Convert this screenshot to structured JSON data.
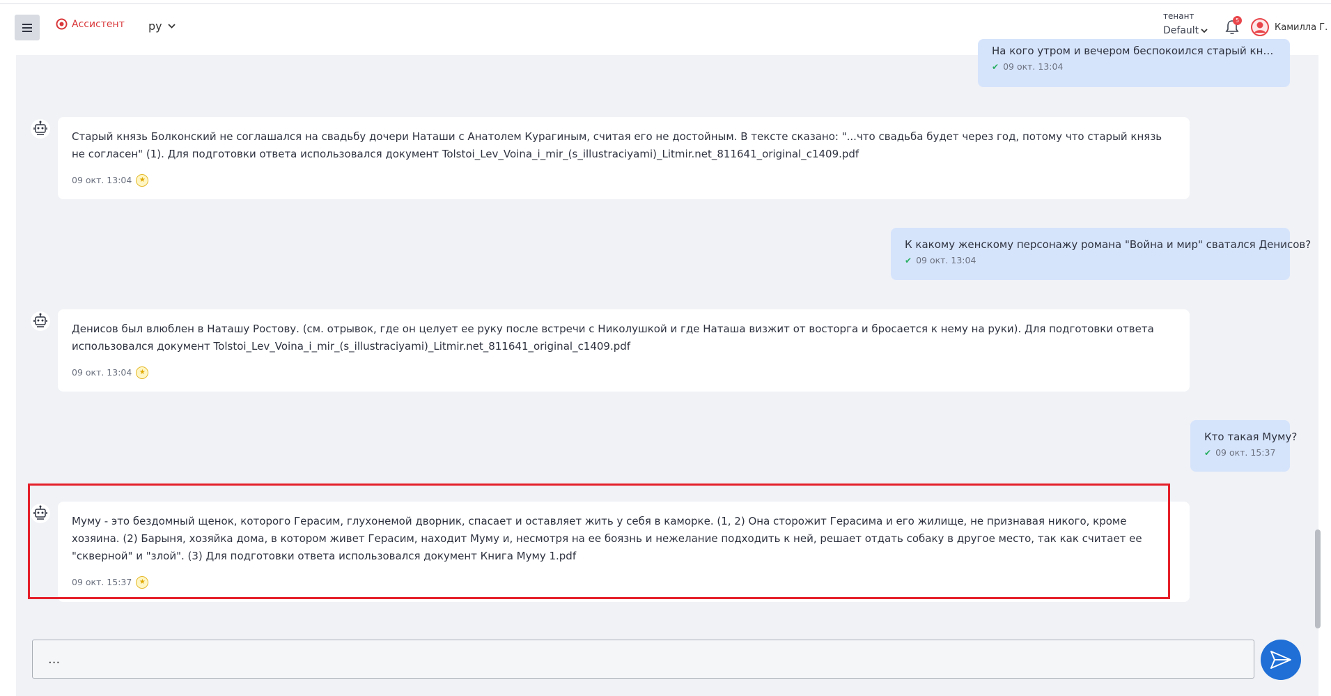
{
  "header": {
    "logo_text": "Ассистент",
    "language": "ру",
    "tenant_label": "тенант",
    "tenant_value": "Default",
    "notifications_count": "5",
    "user_name": "Камилла Г."
  },
  "messages": [
    {
      "role": "user",
      "text": "На кого утром и вечером беспокоился старый князь Болконский?",
      "time": "09 окт. 13:04"
    },
    {
      "role": "bot",
      "text": "Старый князь Болконский не соглашался на свадьбу дочери Наташи с Анатолем Курагиным, считая его не достойным. В тексте сказано: \"...что свадьба будет через год, потому что старый князь не согласен\" (1). Для подготовки ответа использовался документ Tolstoi_Lev_Voina_i_mir_(s_illustraciyami)_Litmir.net_811641_original_c1409.pdf",
      "time": "09 окт. 13:04"
    },
    {
      "role": "user",
      "text": "К какому женскому персонажу романа \"Война и мир\" сватался Денисов?",
      "time": "09 окт. 13:04"
    },
    {
      "role": "bot",
      "text": "Денисов был влюблен в Наташу Ростову. (см. отрывок, где он целует ее руку после встречи с Николушкой и где Наташа визжит от восторга и бросается к нему на руки). Для подготовки ответа использовался документ Tolstoi_Lev_Voina_i_mir_(s_illustraciyami)_Litmir.net_811641_original_c1409.pdf",
      "time": "09 окт. 13:04"
    },
    {
      "role": "user",
      "text": "Кто такая Муму?",
      "time": "09 окт. 15:37"
    },
    {
      "role": "bot",
      "text": "Муму - это бездомный щенок, которого Герасим, глухонемой дворник, спасает и оставляет жить у себя в каморке. (1, 2) Она сторожит Герасима и его жилище, не признавая никого, кроме хозяина. (2) Барыня, хозяйка дома, в котором живет Герасим, находит Муму и, несмотря на ее боязнь и нежелание подходить к ней, решает отдать собаку в другое место, так как считает ее \"скверной\" и \"злой\". (3) Для подготовки ответа использовался документ Книга Муму 1.pdf",
      "time": "09 окт. 15:37"
    }
  ],
  "input": {
    "placeholder": "..."
  },
  "colors": {
    "accent": "#1f6fd6",
    "brand": "#d9373a",
    "user_bubble": "#d6e4fb",
    "highlight": "#e5202a"
  }
}
